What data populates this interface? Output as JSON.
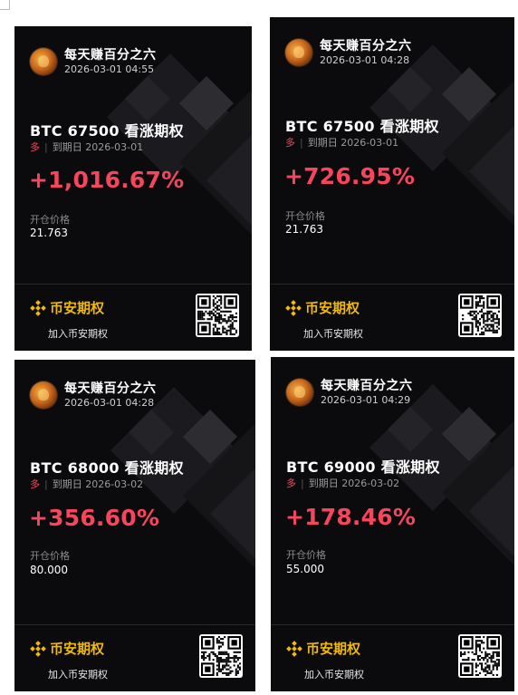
{
  "cards": [
    {
      "username": "每天赚百分之六",
      "timestamp": "2026-03-01 04:55",
      "symbol": "BTC 67500 看涨期权",
      "side": "多",
      "expiry_label": "到期日",
      "expiry_date": "2026-03-01",
      "pnl_percent": "+1,016.67%",
      "entry_label": "开仓价格",
      "entry_price": "21.763",
      "brand_name": "币安期权",
      "join_text": "加入币安期权"
    },
    {
      "username": "每天赚百分之六",
      "timestamp": "2026-03-01 04:28",
      "symbol": "BTC 67500 看涨期权",
      "side": "多",
      "expiry_label": "到期日",
      "expiry_date": "2026-03-01",
      "pnl_percent": "+726.95%",
      "entry_label": "开仓价格",
      "entry_price": "21.763",
      "brand_name": "币安期权",
      "join_text": "加入币安期权"
    },
    {
      "username": "每天赚百分之六",
      "timestamp": "2026-03-01 04:28",
      "symbol": "BTC 68000 看涨期权",
      "side": "多",
      "expiry_label": "到期日",
      "expiry_date": "2026-03-02",
      "pnl_percent": "+356.60%",
      "entry_label": "开仓价格",
      "entry_price": "80.000",
      "brand_name": "币安期权",
      "join_text": "加入币安期权"
    },
    {
      "username": "每天赚百分之六",
      "timestamp": "2026-03-01 04:29",
      "symbol": "BTC 69000 看涨期权",
      "side": "多",
      "expiry_label": "到期日",
      "expiry_date": "2026-03-02",
      "pnl_percent": "+178.46%",
      "entry_label": "开仓价格",
      "entry_price": "55.000",
      "brand_name": "币安期权",
      "join_text": "加入币安期权"
    }
  ],
  "colors": {
    "profit_red": "#f6465d",
    "brand_yellow": "#f0b90b",
    "card_bg": "#0b0b0d"
  },
  "icons": {
    "avatar": "avatar-lion-icon",
    "logo": "binance-logo-icon",
    "qr": "qr-code-icon",
    "background": "binance-diamond-pattern"
  }
}
